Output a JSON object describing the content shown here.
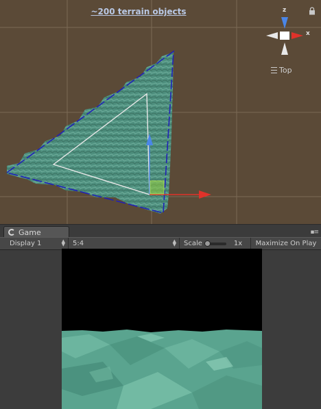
{
  "scene": {
    "title": "~200 terrain objects",
    "gizmo": {
      "x_label": "x",
      "z_label": "z",
      "x_color": "#e0322a",
      "z_color": "#4a86e8"
    },
    "view_label": "Top",
    "icons": [
      "lock-icon",
      "view-menu-icon",
      "move-arrow-x-icon",
      "move-arrow-z-icon"
    ],
    "colors": {
      "background": "#5b4a37",
      "grid": "#7b6a55",
      "terrain": "#4e8f7e",
      "selection_outline": "#2121b8",
      "wire_triangle": "#e8e8e8"
    }
  },
  "game": {
    "tab_label": "Game",
    "display": "Display 1",
    "aspect": "5:4",
    "scale_label": "Scale",
    "scale_value": "1x",
    "maximize_label": "Maximize On Play",
    "colors": {
      "sky": "#000000",
      "terrain": "#5aa48f"
    }
  }
}
